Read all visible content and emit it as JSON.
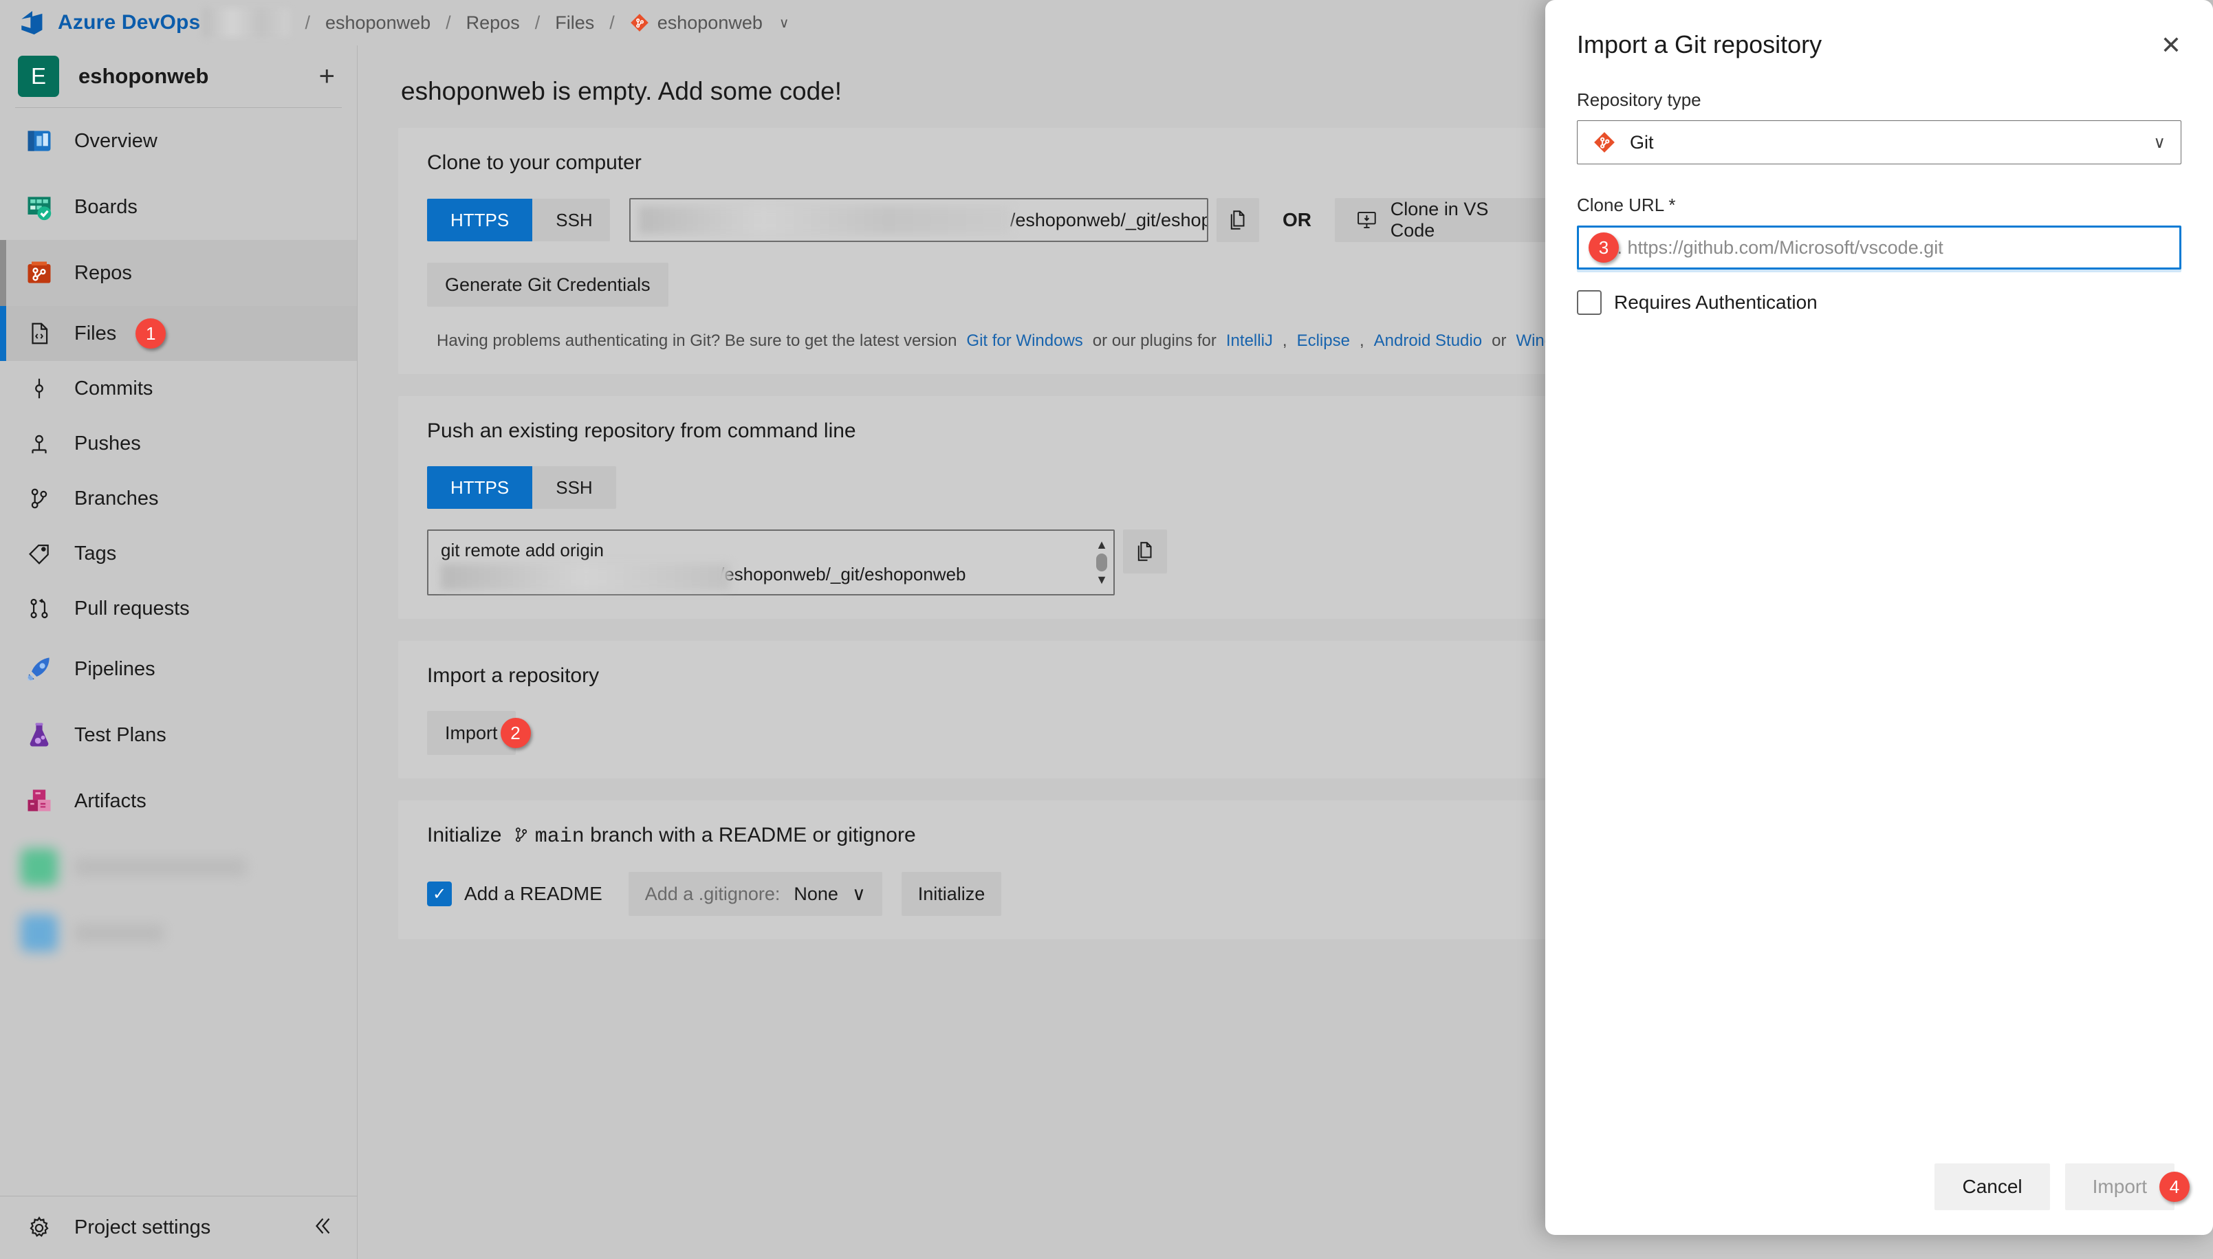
{
  "topbar": {
    "product_name": "Azure DevOps",
    "logo_icon": "azure-devops-logo-icon",
    "org_redacted": "",
    "breadcrumbs": [
      {
        "label": "eshoponweb"
      },
      {
        "label": "Repos"
      },
      {
        "label": "Files"
      },
      {
        "label": "eshoponweb",
        "icon": "git-repo-icon"
      }
    ],
    "separator": "/",
    "repo_chevron": "∨"
  },
  "sidebar": {
    "project_initial": "E",
    "project_name": "eshoponweb",
    "add_label": "+",
    "items": [
      {
        "label": "Overview",
        "icon": "overview-icon"
      },
      {
        "label": "Boards",
        "icon": "boards-icon"
      },
      {
        "label": "Repos",
        "icon": "repos-icon"
      },
      {
        "label": "Files",
        "icon": "files-icon",
        "badge": "1"
      },
      {
        "label": "Commits",
        "icon": "commits-icon"
      },
      {
        "label": "Pushes",
        "icon": "pushes-icon"
      },
      {
        "label": "Branches",
        "icon": "branches-icon"
      },
      {
        "label": "Tags",
        "icon": "tags-icon"
      },
      {
        "label": "Pull requests",
        "icon": "pull-requests-icon"
      },
      {
        "label": "Pipelines",
        "icon": "pipelines-icon"
      },
      {
        "label": "Test Plans",
        "icon": "test-plans-icon"
      },
      {
        "label": "Artifacts",
        "icon": "artifacts-icon"
      }
    ],
    "project_settings": {
      "label": "Project settings",
      "icon": "gear-icon",
      "collapse_icon": "chevron-double-left-icon"
    }
  },
  "main": {
    "page_title": "eshoponweb is empty. Add some code!",
    "clone": {
      "title": "Clone to your computer",
      "tabs": [
        {
          "label": "HTTPS",
          "selected": true
        },
        {
          "label": "SSH",
          "selected": false
        }
      ],
      "url_text": "/eshoponweb/_git/eshop",
      "copy_icon": "copy-icon",
      "or_label": "OR",
      "vscode_button": "Clone in VS Code",
      "vscode_icon": "monitor-download-icon",
      "generate_button": "Generate Git Credentials",
      "help_icon": "info-icon",
      "help_prefix": "Having problems authenticating in Git? Be sure to get the latest version",
      "help_link1": "Git for Windows",
      "help_middle": "or our plugins for",
      "help_links": [
        "IntelliJ",
        "Eclipse",
        "Android Studio"
      ],
      "help_or": "or",
      "help_link_last": "Windows"
    },
    "push": {
      "title": "Push an existing repository from command line",
      "tabs": [
        {
          "label": "HTTPS",
          "selected": true
        },
        {
          "label": "SSH",
          "selected": false
        }
      ],
      "command_line1": "git remote add origin",
      "command_line2": "/eshoponweb/_git/eshoponweb",
      "copy_icon": "copy-icon",
      "scroll_up_icon": "triangle-up-icon",
      "scroll_down_icon": "triangle-down-icon"
    },
    "import": {
      "title": "Import a repository",
      "button": "Import",
      "badge": "2"
    },
    "initialize": {
      "title_prefix": "Initialize",
      "branch_icon": "branch-icon",
      "branch_name": "main",
      "title_suffix": "branch with a README or gitignore",
      "readme_checkbox": {
        "label": "Add a README",
        "checked": true
      },
      "gitignore_label": "Add a .gitignore:",
      "gitignore_value": "None",
      "gitignore_chevron": "∨",
      "initialize_button": "Initialize"
    }
  },
  "dialog": {
    "title": "Import a Git repository",
    "close_icon": "close-icon",
    "repo_type_label": "Repository type",
    "repo_type_value": "Git",
    "repo_type_icon": "git-icon",
    "repo_type_chevron": "∨",
    "clone_url_label": "Clone URL *",
    "clone_url_value": "",
    "clone_url_placeholder": "e.g. https://github.com/Microsoft/vscode.git",
    "clone_url_badge": "3",
    "requires_auth": {
      "label": "Requires Authentication",
      "checked": false
    },
    "cancel_button": "Cancel",
    "import_button": "Import",
    "import_badge": "4",
    "import_disabled": true
  },
  "colors": {
    "accent": "#0b6fc4",
    "badge_red": "#f4453c",
    "link": "#1763ad",
    "project_green": "#056f5a",
    "git_orange": "#e8502a"
  }
}
